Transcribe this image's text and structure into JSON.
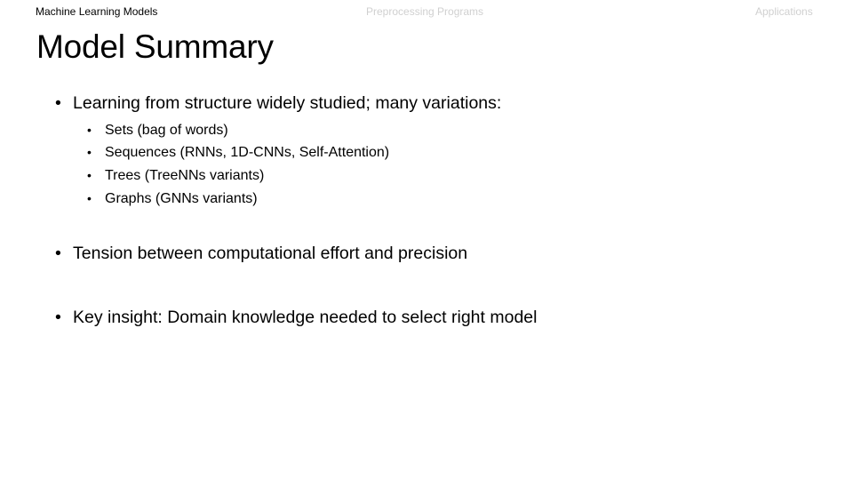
{
  "nav": {
    "items": [
      {
        "label": "Machine Learning Models",
        "active": true
      },
      {
        "label": "Preprocessing Programs",
        "active": false
      },
      {
        "label": "Applications",
        "active": false
      }
    ]
  },
  "slide": {
    "title": "Model Summary",
    "bullet_symbol": "•",
    "bullets": [
      {
        "text": "Learning from structure widely studied; many variations:",
        "sub": [
          "Sets (bag of words)",
          "Sequences (RNNs, 1D-CNNs, Self-Attention)",
          "Trees (TreeNNs variants)",
          "Graphs (GNNs variants)"
        ]
      },
      {
        "text": "Tension between computational effort and precision",
        "sub": []
      },
      {
        "text": "Key insight: Domain knowledge needed to select right model",
        "sub": []
      }
    ]
  }
}
